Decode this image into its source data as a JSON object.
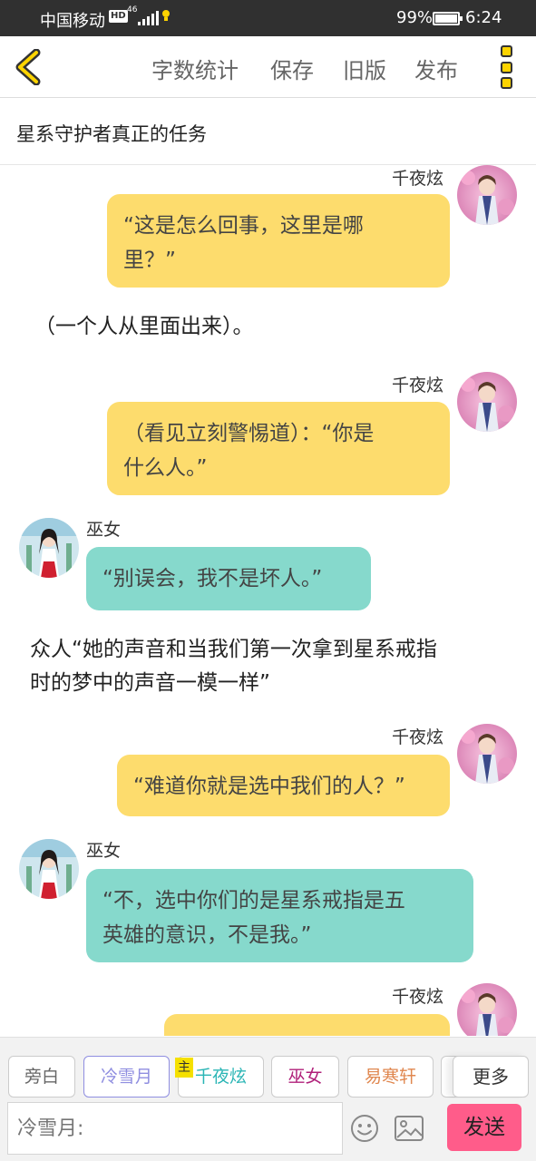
{
  "status_bar": {
    "carrier": "中国移动",
    "hd": "HD",
    "network": "46",
    "battery": "99%",
    "time": "6:24"
  },
  "nav": {
    "word_count": "字数统计",
    "save": "保存",
    "old_version": "旧版",
    "publish": "发布"
  },
  "title": "星系守护者真正的任务",
  "messages": [
    {
      "type": "right",
      "speaker": "千夜炫",
      "text_l1": "“这是怎么回事，这里是哪",
      "text_l2": "里？”"
    },
    {
      "type": "narration",
      "text": "（一个人从里面出来）。"
    },
    {
      "type": "right",
      "speaker": "千夜炫",
      "text_l1": "（看见立刻警惕道）：“你是",
      "text_l2": "什么人。”"
    },
    {
      "type": "left",
      "speaker": "巫女",
      "text_l1": "“别误会，我不是坏人。”"
    },
    {
      "type": "narration",
      "text_l1": "众人“她的声音和当我们第一次拿到星系戒指",
      "text_l2": "时的梦中的声音一模一样”"
    },
    {
      "type": "right",
      "speaker": "千夜炫",
      "text_l1": "“难道你就是选中我们的人？”"
    },
    {
      "type": "left",
      "speaker": "巫女",
      "text_l1": "“不，选中你们的是星系戒指是五",
      "text_l2": "英雄的意识，不是我。”"
    },
    {
      "type": "right",
      "speaker": "千夜炫"
    }
  ],
  "roles": [
    {
      "label": "旁白",
      "color": "#666666"
    },
    {
      "label": "冷雪月",
      "color": "#8f8ee0"
    },
    {
      "label": "千夜炫",
      "color": "#2ab5b5"
    },
    {
      "label": "巫女",
      "color": "#b0207a"
    },
    {
      "label": "易寒轩",
      "color": "#e0874f"
    }
  ],
  "main_badge": "主",
  "more": "更多",
  "input_placeholder": "冷雪月:",
  "send": "发送"
}
